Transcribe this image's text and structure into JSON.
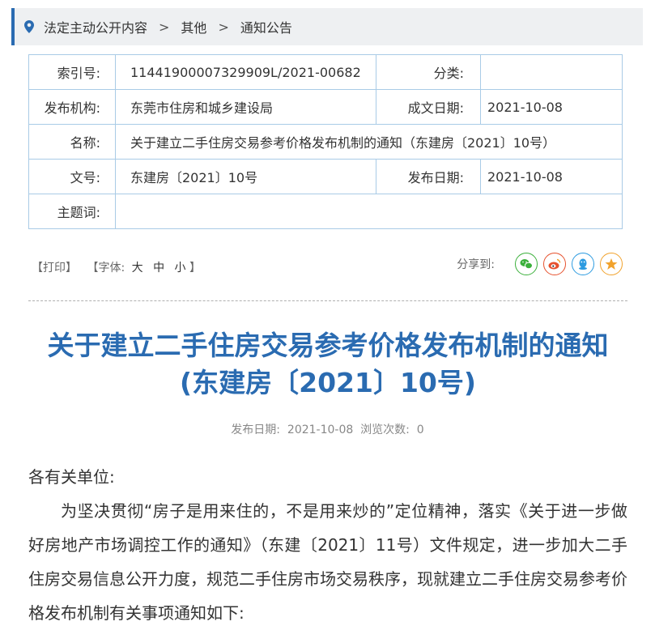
{
  "breadcrumb": {
    "items": [
      "法定主动公开内容",
      "其他",
      "通知公告"
    ],
    "separator": ">"
  },
  "meta": {
    "index_label": "索引号:",
    "index_value": "11441900007329909L/2021-00682",
    "category_label": "分类:",
    "category_value": "",
    "org_label": "发布机构:",
    "org_value": "东莞市住房和城乡建设局",
    "date_made_label": "成文日期:",
    "date_made_value": "2021-10-08",
    "name_label": "名称:",
    "name_value": "关于建立二手住房交易参考价格发布机制的通知（东建房〔2021〕10号）",
    "docno_label": "文号:",
    "docno_value": "东建房〔2021〕10号",
    "pub_date_label": "发布日期:",
    "pub_date_value": "2021-10-08",
    "subject_label": "主题词:",
    "subject_value": ""
  },
  "tools": {
    "print": "【打印】",
    "font_prefix": "【字体:",
    "font_large": "大",
    "font_medium": "中",
    "font_small": "小",
    "font_suffix": "】",
    "share_label": "分享到:",
    "share_icons": [
      "wechat-icon",
      "weibo-icon",
      "qq-icon",
      "qzone-icon"
    ],
    "colors": {
      "wechat": "#3bb03b",
      "weibo": "#e6512d",
      "qq": "#2d9be0",
      "qzone": "#f1a22c"
    }
  },
  "article": {
    "title_line1": "关于建立二手住房交易参考价格发布机制的通知",
    "title_line2": "(东建房〔2021〕10号)",
    "pub_date": "发布日期:  2021-10-08  浏览次数:  0",
    "greeting": "各有关单位:",
    "paragraph1": "为坚决贯彻“房子是用来住的，不是用来炒的”定位精神，落实《关于进一步做好房地产市场调控工作的通知》（东建〔2021〕11号）文件规定，进一步加大二手住房交易信息公开力度，规范二手住房市场交易秩序，现就建立二手住房交易参考价格发布机制有关事项通知如下:"
  },
  "accent_color": "#2a6bb1"
}
